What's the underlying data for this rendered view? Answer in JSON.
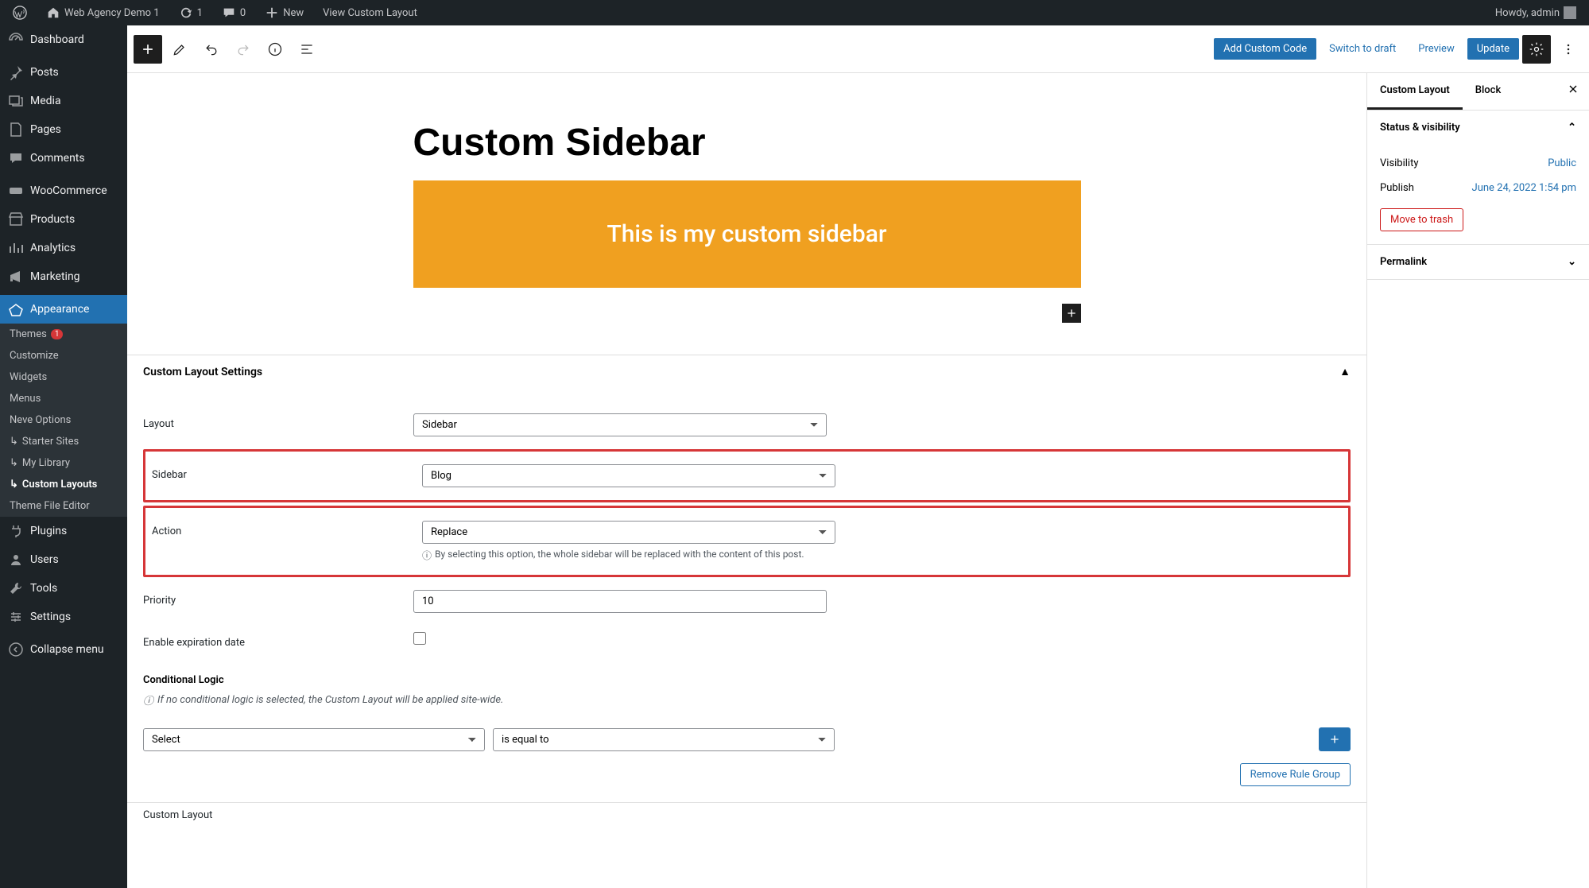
{
  "admin_bar": {
    "site_name": "Web Agency Demo 1",
    "updates": "1",
    "comments": "0",
    "new_label": "New",
    "view_label": "View Custom Layout",
    "howdy": "Howdy, admin"
  },
  "sidebar": {
    "items": [
      {
        "label": "Dashboard"
      },
      {
        "label": "Posts"
      },
      {
        "label": "Media"
      },
      {
        "label": "Pages"
      },
      {
        "label": "Comments"
      },
      {
        "label": "WooCommerce"
      },
      {
        "label": "Products"
      },
      {
        "label": "Analytics"
      },
      {
        "label": "Marketing"
      },
      {
        "label": "Appearance"
      },
      {
        "label": "Plugins"
      },
      {
        "label": "Users"
      },
      {
        "label": "Tools"
      },
      {
        "label": "Settings"
      },
      {
        "label": "Collapse menu"
      }
    ],
    "submenu": {
      "themes": "Themes",
      "themes_badge": "1",
      "customize": "Customize",
      "widgets": "Widgets",
      "menus": "Menus",
      "neve": "Neve Options",
      "starter": "Starter Sites",
      "library": "My Library",
      "custom_layouts": "Custom Layouts",
      "tfe": "Theme File Editor"
    }
  },
  "topbar": {
    "add_custom_code": "Add Custom Code",
    "switch_draft": "Switch to draft",
    "preview": "Preview",
    "update": "Update"
  },
  "post": {
    "title": "Custom Sidebar",
    "block_text": "This is my custom sidebar"
  },
  "cls": {
    "heading": "Custom Layout Settings",
    "layout_label": "Layout",
    "layout_value": "Sidebar",
    "sidebar_label": "Sidebar",
    "sidebar_value": "Blog",
    "action_label": "Action",
    "action_value": "Replace",
    "action_hint": "By selecting this option, the whole sidebar will be replaced with the content of this post.",
    "priority_label": "Priority",
    "priority_value": "10",
    "expiration_label": "Enable expiration date",
    "cond_logic": "Conditional Logic",
    "cond_hint": "If no conditional logic is selected, the Custom Layout will be applied site-wide.",
    "rule_select": "Select",
    "rule_operator": "is equal to",
    "remove_rule": "Remove Rule Group",
    "breadcrumb": "Custom Layout"
  },
  "right_panel": {
    "tab1": "Custom Layout",
    "tab2": "Block",
    "status_heading": "Status & visibility",
    "visibility_label": "Visibility",
    "visibility_value": "Public",
    "publish_label": "Publish",
    "publish_value": "June 24, 2022 1:54 pm",
    "trash": "Move to trash",
    "permalink": "Permalink"
  }
}
